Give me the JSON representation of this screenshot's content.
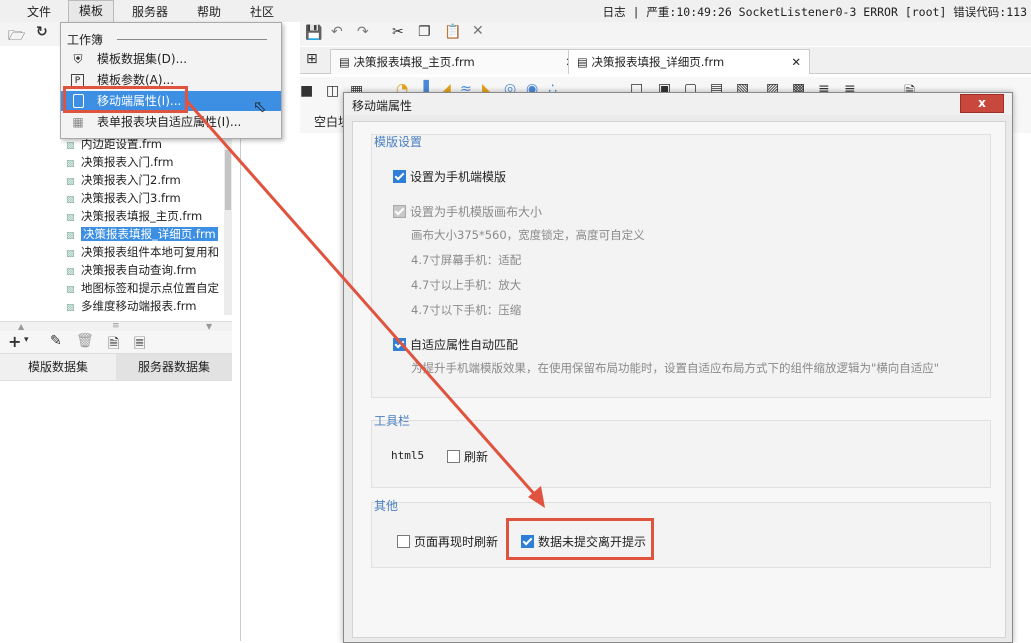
{
  "menubar": {
    "items": [
      "文件",
      "模板",
      "服务器",
      "帮助",
      "社区"
    ],
    "status": "日志 | 严重:10:49:26 SocketListener0-3 ERROR [root] 错误代码:113"
  },
  "dropdown": {
    "header": "工作簿",
    "items": [
      {
        "label": "模板数据集(D)...",
        "icon": "database-icon"
      },
      {
        "label": "模板参数(A)...",
        "icon": "parameter-icon"
      },
      {
        "label": "移动端属性(I)...",
        "icon": "mobile-icon"
      },
      {
        "label": "表单报表块自适应属性(I)...",
        "icon": "form-icon"
      }
    ]
  },
  "file_tree": {
    "items": [
      "内边距设置.frm",
      "决策报表入门.frm",
      "决策报表入门2.frm",
      "决策报表入门3.frm",
      "决策报表填报_主页.frm",
      "决策报表填报_详细页.frm",
      "决策报表组件本地可复用和",
      "决策报表自动查询.frm",
      "地图标签和提示点位置自定",
      "多维度移动端报表.frm"
    ],
    "selected_index": 5
  },
  "left_bottom_tabs": [
    "模版数据集",
    "服务器数据集"
  ],
  "editor": {
    "tabs": [
      "决策报表填报_主页.frm",
      "决策报表填报_详细页.frm"
    ],
    "blank_label": "空白块"
  },
  "dialog": {
    "title": "移动端属性",
    "close": "x",
    "template_settings": {
      "title": "模版设置",
      "set_mobile": "设置为手机端模版",
      "set_canvas": "设置为手机模版画布大小",
      "canvas_desc": "画布大小375*560，宽度锁定，高度可自定义",
      "rule1": "4.7寸屏幕手机：适配",
      "rule2": "4.7寸以上手机：放大",
      "rule3": "4.7寸以下手机：压缩",
      "auto_match": "自适应属性自动匹配",
      "auto_match_desc": "为提升手机端模版效果，在使用保留布局功能时，设置自适应布局方式下的组件缩放逻辑为\"横向自适应\""
    },
    "toolbar": {
      "title": "工具栏",
      "html5": "html5",
      "refresh": "刷新"
    },
    "other": {
      "title": "其他",
      "page_refresh": "页面再现时刷新",
      "unsubmitted_prompt": "数据未提交离开提示"
    },
    "checked": {
      "set_mobile": true,
      "set_canvas": true,
      "auto_match": true,
      "refresh": false,
      "page_refresh": false,
      "unsubmitted_prompt": true
    }
  },
  "colors": {
    "highlight": "#3d8fe3",
    "annotation": "#e0533f",
    "group_title": "#4a7fc1"
  }
}
